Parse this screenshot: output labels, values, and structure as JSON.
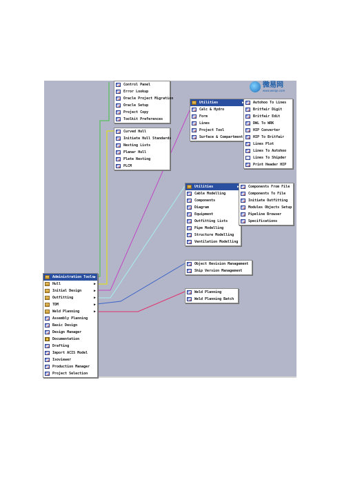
{
  "logo": {
    "title": "微易网",
    "url": "www.weiqe.com"
  },
  "main_menu": {
    "items": [
      {
        "label": "Administration Tools",
        "submenu": true,
        "icon": "folder-icon"
      },
      {
        "label": "Hull",
        "submenu": true,
        "icon": "folder-icon"
      },
      {
        "label": "Initial Design",
        "submenu": true,
        "icon": "folder-icon"
      },
      {
        "label": "Outfitting",
        "submenu": true,
        "icon": "folder-icon"
      },
      {
        "label": "TDM",
        "submenu": true,
        "icon": "folder-icon"
      },
      {
        "label": "Weld Planning",
        "submenu": true,
        "icon": "folder-icon"
      },
      {
        "label": "Assembly Planning",
        "submenu": false,
        "icon": "app-icon"
      },
      {
        "label": "Basic Design",
        "submenu": false,
        "icon": "app-icon"
      },
      {
        "label": "Design Manager",
        "submenu": false,
        "icon": "app-icon"
      },
      {
        "label": "Documentation",
        "submenu": false,
        "icon": "key-icon"
      },
      {
        "label": "Drafting",
        "submenu": false,
        "icon": "app-icon"
      },
      {
        "label": "Import ACIS Model",
        "submenu": false,
        "icon": "app-icon"
      },
      {
        "label": "Isoviewer",
        "submenu": false,
        "icon": "app-icon"
      },
      {
        "label": "Production Manager",
        "submenu": false,
        "icon": "app-icon"
      },
      {
        "label": "Project Selection",
        "submenu": false,
        "icon": "app-icon"
      }
    ]
  },
  "admin_menu": {
    "items": [
      {
        "label": "Control Panel"
      },
      {
        "label": "Error Lookup"
      },
      {
        "label": "Oracle Project Migration"
      },
      {
        "label": "Oracle Setup"
      },
      {
        "label": "Project Copy"
      },
      {
        "label": "Toolkit Preferences"
      }
    ]
  },
  "hull_menu": {
    "items": [
      {
        "label": "Curved Hull"
      },
      {
        "label": "Initiate Hull Standards"
      },
      {
        "label": "Nesting Lists"
      },
      {
        "label": "Planar Hull"
      },
      {
        "label": "Plate Nesting"
      },
      {
        "label": "PLCM"
      }
    ]
  },
  "initial_menu": {
    "items": [
      {
        "label": "Utilities",
        "submenu": true
      },
      {
        "label": "Calc & Hydro",
        "submenu": false
      },
      {
        "label": "Form",
        "submenu": false
      },
      {
        "label": "Lines",
        "submenu": false
      },
      {
        "label": "Project Tool",
        "submenu": false
      },
      {
        "label": "Surface & Compartment",
        "submenu": false
      }
    ]
  },
  "initial_util_menu": {
    "items": [
      {
        "label": "Autohoo To Lines"
      },
      {
        "label": "Britfair Digit"
      },
      {
        "label": "Britfair Edit"
      },
      {
        "label": "DWL To WRK"
      },
      {
        "label": "HIP Converter"
      },
      {
        "label": "HIP To Britfair"
      },
      {
        "label": "Lines Plot"
      },
      {
        "label": "Lines To Autohoo"
      },
      {
        "label": "Lines To Shipder"
      },
      {
        "label": "Print Header HIP"
      }
    ]
  },
  "outfit_menu": {
    "items": [
      {
        "label": "Utilities",
        "submenu": true
      },
      {
        "label": "Cable Modelling",
        "submenu": false
      },
      {
        "label": "Components",
        "submenu": false
      },
      {
        "label": "Diagram",
        "submenu": false
      },
      {
        "label": "Equipment",
        "submenu": false
      },
      {
        "label": "Outfitting Lists",
        "submenu": false
      },
      {
        "label": "Pipe Modelling",
        "submenu": false
      },
      {
        "label": "Structure Modelling",
        "submenu": false
      },
      {
        "label": "Ventilation Modelling",
        "submenu": false
      }
    ]
  },
  "outfit_util_menu": {
    "items": [
      {
        "label": "Components From File"
      },
      {
        "label": "Components To File"
      },
      {
        "label": "Initiate Outfitting"
      },
      {
        "label": "Modules Objects Setup"
      },
      {
        "label": "Pipeline Browser"
      },
      {
        "label": "Specifications"
      }
    ]
  },
  "tdm_menu": {
    "items": [
      {
        "label": "Object Revision Management"
      },
      {
        "label": "Ship Version Management"
      }
    ]
  },
  "weld_menu": {
    "items": [
      {
        "label": "Weld Planning"
      },
      {
        "label": "Weld Planning Batch"
      }
    ]
  },
  "colors": {
    "desktop": "#b3b6c9",
    "highlight": "#2a4fa0",
    "admin_line": "#e6e600",
    "hull_line": "#41c341",
    "initial_line": "#c244c2",
    "outfit_line": "#a8f0f0",
    "tdm_line": "#3a63c7",
    "weld_line": "#e0306a"
  }
}
